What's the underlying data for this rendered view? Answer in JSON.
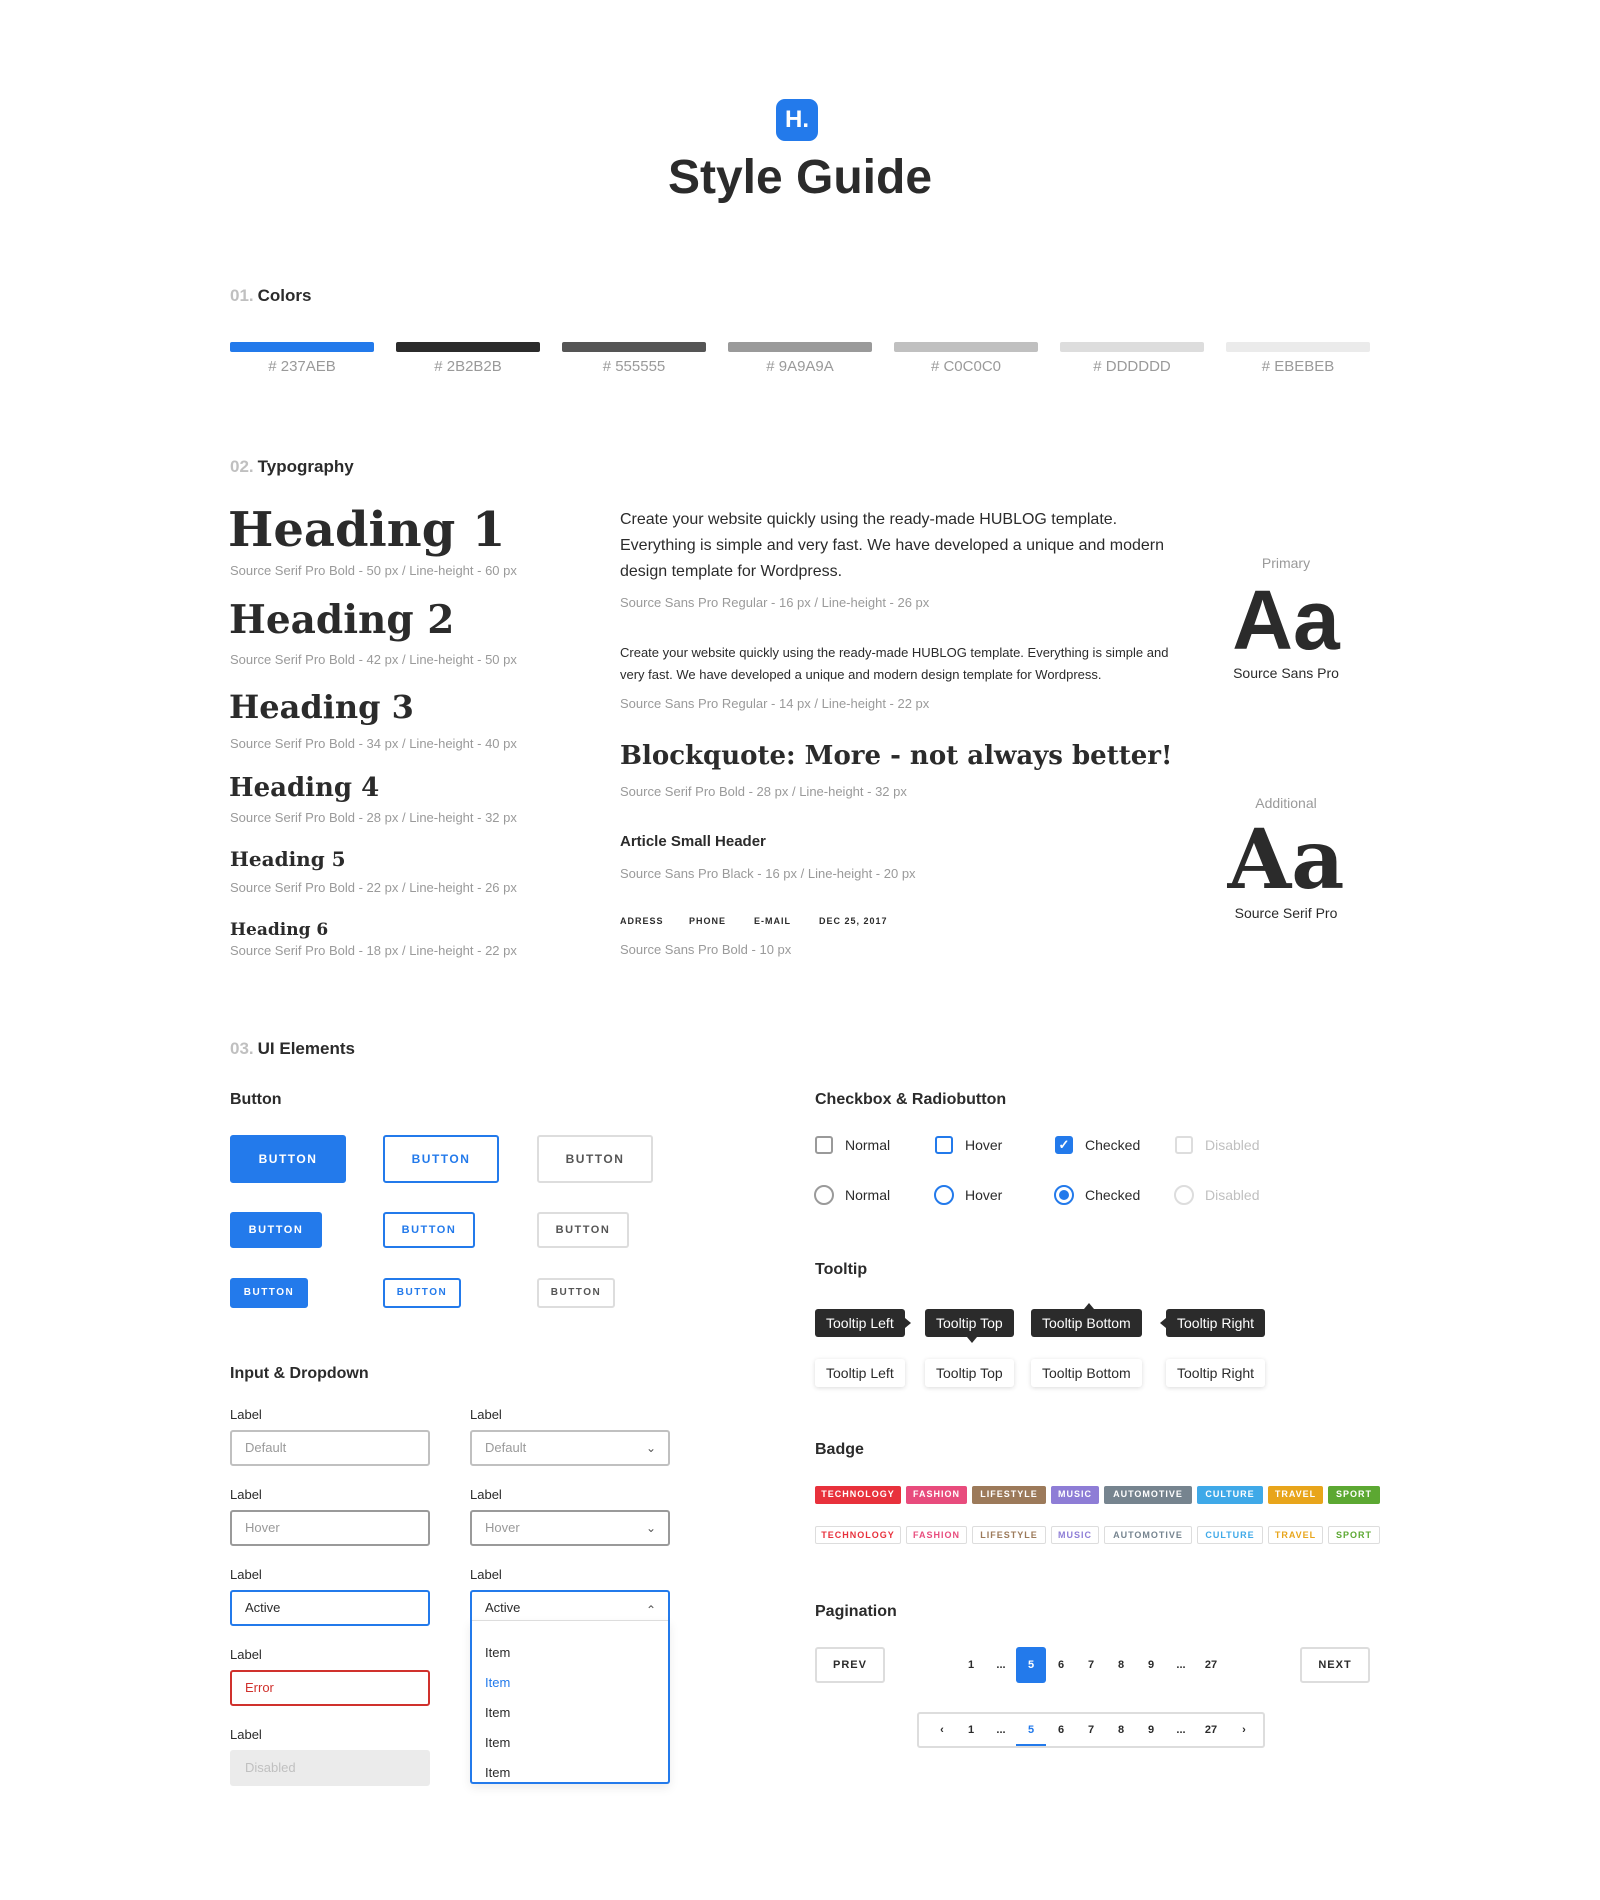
{
  "header": {
    "logo_letter": "H.",
    "title": "Style Guide"
  },
  "colors": {
    "num": "01.",
    "title": "Colors",
    "swatches": [
      {
        "hex": "#237AEB",
        "label": "# 237AEB"
      },
      {
        "hex": "#2B2B2B",
        "label": "# 2B2B2B"
      },
      {
        "hex": "#555555",
        "label": "# 555555"
      },
      {
        "hex": "#9A9A9A",
        "label": "# 9A9A9A"
      },
      {
        "hex": "#C0C0C0",
        "label": "# C0C0C0"
      },
      {
        "hex": "#DDDDDD",
        "label": "# DDDDDD"
      },
      {
        "hex": "#EBEBEB",
        "label": "# EBEBEB"
      }
    ]
  },
  "typography": {
    "num": "02.",
    "title": "Typography",
    "headings": [
      {
        "text": "Heading 1",
        "meta": "Source Serif Pro Bold - 50 px  /  Line-height - 60 px"
      },
      {
        "text": "Heading 2",
        "meta": "Source Serif Pro Bold - 42 px  /  Line-height - 50 px"
      },
      {
        "text": "Heading 3",
        "meta": "Source Serif Pro Bold - 34 px  /  Line-height - 40 px"
      },
      {
        "text": "Heading 4",
        "meta": "Source Serif Pro Bold - 28 px  /  Line-height - 32 px"
      },
      {
        "text": "Heading 5",
        "meta": "Source Serif Pro Bold - 22 px  /  Line-height - 26 px"
      },
      {
        "text": "Heading 6",
        "meta": "Source Serif Pro Bold - 18 px  /  Line-height - 22 px"
      }
    ],
    "body_large": "Create your website quickly using the ready-made HUBLOG template. Everything is simple and very fast. We have developed a unique and modern design template for Wordpress.",
    "body_large_meta": "Source Sans Pro Regular - 16 px  /  Line-height - 26 px",
    "body_small": "Create your website quickly using the ready-made HUBLOG template. Everything is simple and very fast. We have developed a unique and modern design template for Wordpress.",
    "body_small_meta": "Source Sans Pro Regular - 14 px  /  Line-height - 22 px",
    "blockquote": "Blockquote: More - not always better!",
    "blockquote_meta": "Source Serif Pro Bold - 28 px  /  Line-height - 32 px",
    "small_header": "Article Small Header",
    "small_header_meta": "Source Sans Pro Black - 16 px  /  Line-height - 20 px",
    "caps": [
      "ADRESS",
      "PHONE",
      "E-MAIL",
      "DEC 25, 2017"
    ],
    "caps_meta": "Source Sans Pro Bold - 10 px",
    "primary": {
      "caption": "Primary",
      "sample": "Aa",
      "name": "Source Sans Pro"
    },
    "additional": {
      "caption": "Additional",
      "sample": "Aa",
      "name": "Source Serif Pro"
    }
  },
  "ui": {
    "num": "03.",
    "title": "UI Elements",
    "button_title": "Button",
    "button_label": "BUTTON",
    "input_title": "Input & Dropdown",
    "inputs": [
      {
        "label": "Label",
        "value": "Default"
      },
      {
        "label": "Label",
        "value": "Hover"
      },
      {
        "label": "Label",
        "value": "Active"
      },
      {
        "label": "Label",
        "value": "Error"
      },
      {
        "label": "Label",
        "value": "Disabled"
      }
    ],
    "dropdowns": [
      {
        "label": "Label",
        "value": "Default"
      },
      {
        "label": "Label",
        "value": "Hover"
      },
      {
        "label": "Label",
        "value": "Active"
      }
    ],
    "dropdown_items": [
      "Item",
      "Item",
      "Item",
      "Item",
      "Item"
    ],
    "check_title": "Checkbox & Radiobutton",
    "check_labels": [
      "Normal",
      "Hover",
      "Checked",
      "Disabled"
    ],
    "tooltip_title": "Tooltip",
    "tooltips": [
      "Tooltip Left",
      "Tooltip Top",
      "Tooltip Bottom",
      "Tooltip Right"
    ],
    "badge_title": "Badge",
    "badges": [
      {
        "label": "TECHNOLOGY",
        "color": "#E8313C"
      },
      {
        "label": "FASHION",
        "color": "#E84C7D"
      },
      {
        "label": "LIFESTYLE",
        "color": "#9C7A5A"
      },
      {
        "label": "MUSIC",
        "color": "#8E7DD6"
      },
      {
        "label": "AUTOMOTIVE",
        "color": "#76848F"
      },
      {
        "label": "CULTURE",
        "color": "#3FA9E8"
      },
      {
        "label": "TRAVEL",
        "color": "#E8A51B"
      },
      {
        "label": "SPORT",
        "color": "#5CA832"
      }
    ],
    "pagination_title": "Pagination",
    "prev": "PREV",
    "next": "NEXT",
    "pages": [
      "1",
      "...",
      "5",
      "6",
      "7",
      "8",
      "9",
      "...",
      "27"
    ],
    "current_page": "5"
  }
}
